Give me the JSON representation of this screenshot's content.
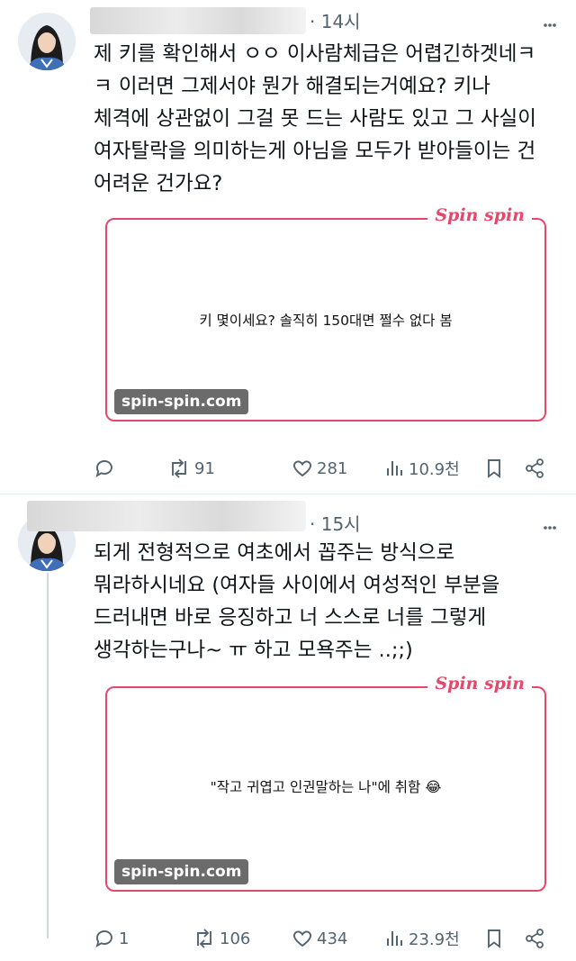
{
  "posts": [
    {
      "time": "· 14시",
      "text": "제 키를 확인해서 ㅇㅇ 이사람체급은 어렵긴하겟네ㅋ\nㅋ 이러면 그제서야 뭔가 해결되는거예요? 키나\n체격에 상관없이 그걸 못 드는 사람도 있고 그 사실이\n여자탈락을 의미하는게 아님을 모두가 받아들이는 건\n어려운 건가요?",
      "card": {
        "logo": "Spin spin",
        "quote": "키 몇이세요? 솔직히 150대면 쩔수 없다 봄",
        "badge": "spin-spin.com"
      },
      "stats": {
        "replies": "",
        "reposts": "91",
        "likes": "281",
        "views": "10.9천"
      }
    },
    {
      "time": "· 15시",
      "text": "되게 전형적으로 여초에서 꼽주는 방식으로\n뭐라하시네요 (여자들 사이에서 여성적인 부분을\n드러내면 바로 응징하고 너 스스로 너를 그렇게\n생각하는구나~ ㅠ 하고 모욕주는 ..;;)",
      "card": {
        "logo": "Spin spin",
        "quote": "\"작고 귀엽고 인권말하는 나\"에 취함 😂",
        "badge": "spin-spin.com"
      },
      "stats": {
        "replies": "1",
        "reposts": "106",
        "likes": "434",
        "views": "23.9천"
      }
    }
  ],
  "icons": {
    "more": "more-icon",
    "reply": "reply-icon",
    "repost": "repost-icon",
    "like": "heart-icon",
    "views": "views-icon",
    "bookmark": "bookmark-icon",
    "share": "share-icon"
  },
  "colors": {
    "accent": "#e4486a",
    "muted": "#536471",
    "text": "#0f1419"
  }
}
